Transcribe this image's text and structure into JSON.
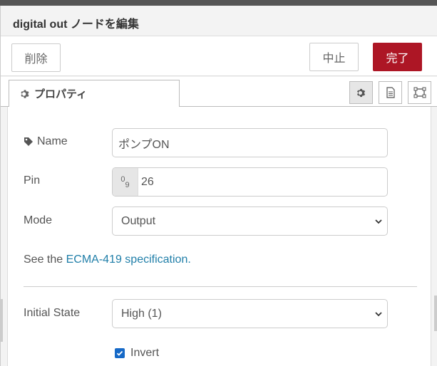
{
  "tray": {
    "title": "digital out ノードを編集"
  },
  "toolbar": {
    "delete_label": "削除",
    "cancel_label": "中止",
    "done_label": "完了"
  },
  "tabs": {
    "properties_label": "プロパティ",
    "icons": [
      "gear-icon",
      "document-icon",
      "frame-icon"
    ]
  },
  "form": {
    "name": {
      "label": "Name",
      "value": "ポンプON"
    },
    "pin": {
      "label": "Pin",
      "badge_top": "0",
      "badge_bottom": "9",
      "value": "26"
    },
    "mode": {
      "label": "Mode",
      "selected": "Output"
    },
    "info": {
      "prefix": "See the ",
      "link": "ECMA-419 specification",
      "suffix": "."
    },
    "initial_state": {
      "label": "Initial State",
      "selected": "High (1)"
    },
    "invert": {
      "label": "Invert",
      "checked": true
    }
  },
  "colors": {
    "accent": "#ad1625",
    "link": "#1f7ea8",
    "checkbox": "#1669c7"
  }
}
